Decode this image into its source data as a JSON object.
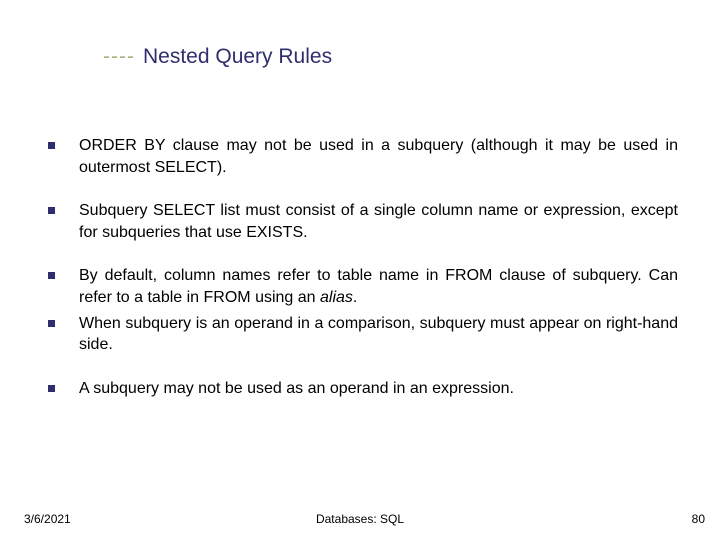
{
  "title": {
    "dashes": "----",
    "text": "Nested Query Rules"
  },
  "bullets": [
    {
      "text": "ORDER BY clause may not be used in a subquery (although it may be used in outermost SELECT)."
    },
    {
      "text": "Subquery SELECT list must consist of a single column name or expression, except for subqueries that use EXISTS."
    },
    {
      "text_pre": "By default, column names refer to table name in FROM clause of subquery. Can refer to a table in FROM using an ",
      "text_em": "alias",
      "text_post": "."
    },
    {
      "text": "When subquery is an operand in a comparison, subquery must appear on right-hand side."
    },
    {
      "text": "A subquery may not be used as an operand in an expression."
    }
  ],
  "footer": {
    "date": "3/6/2021",
    "center": "Databases: SQL",
    "page": "80"
  }
}
